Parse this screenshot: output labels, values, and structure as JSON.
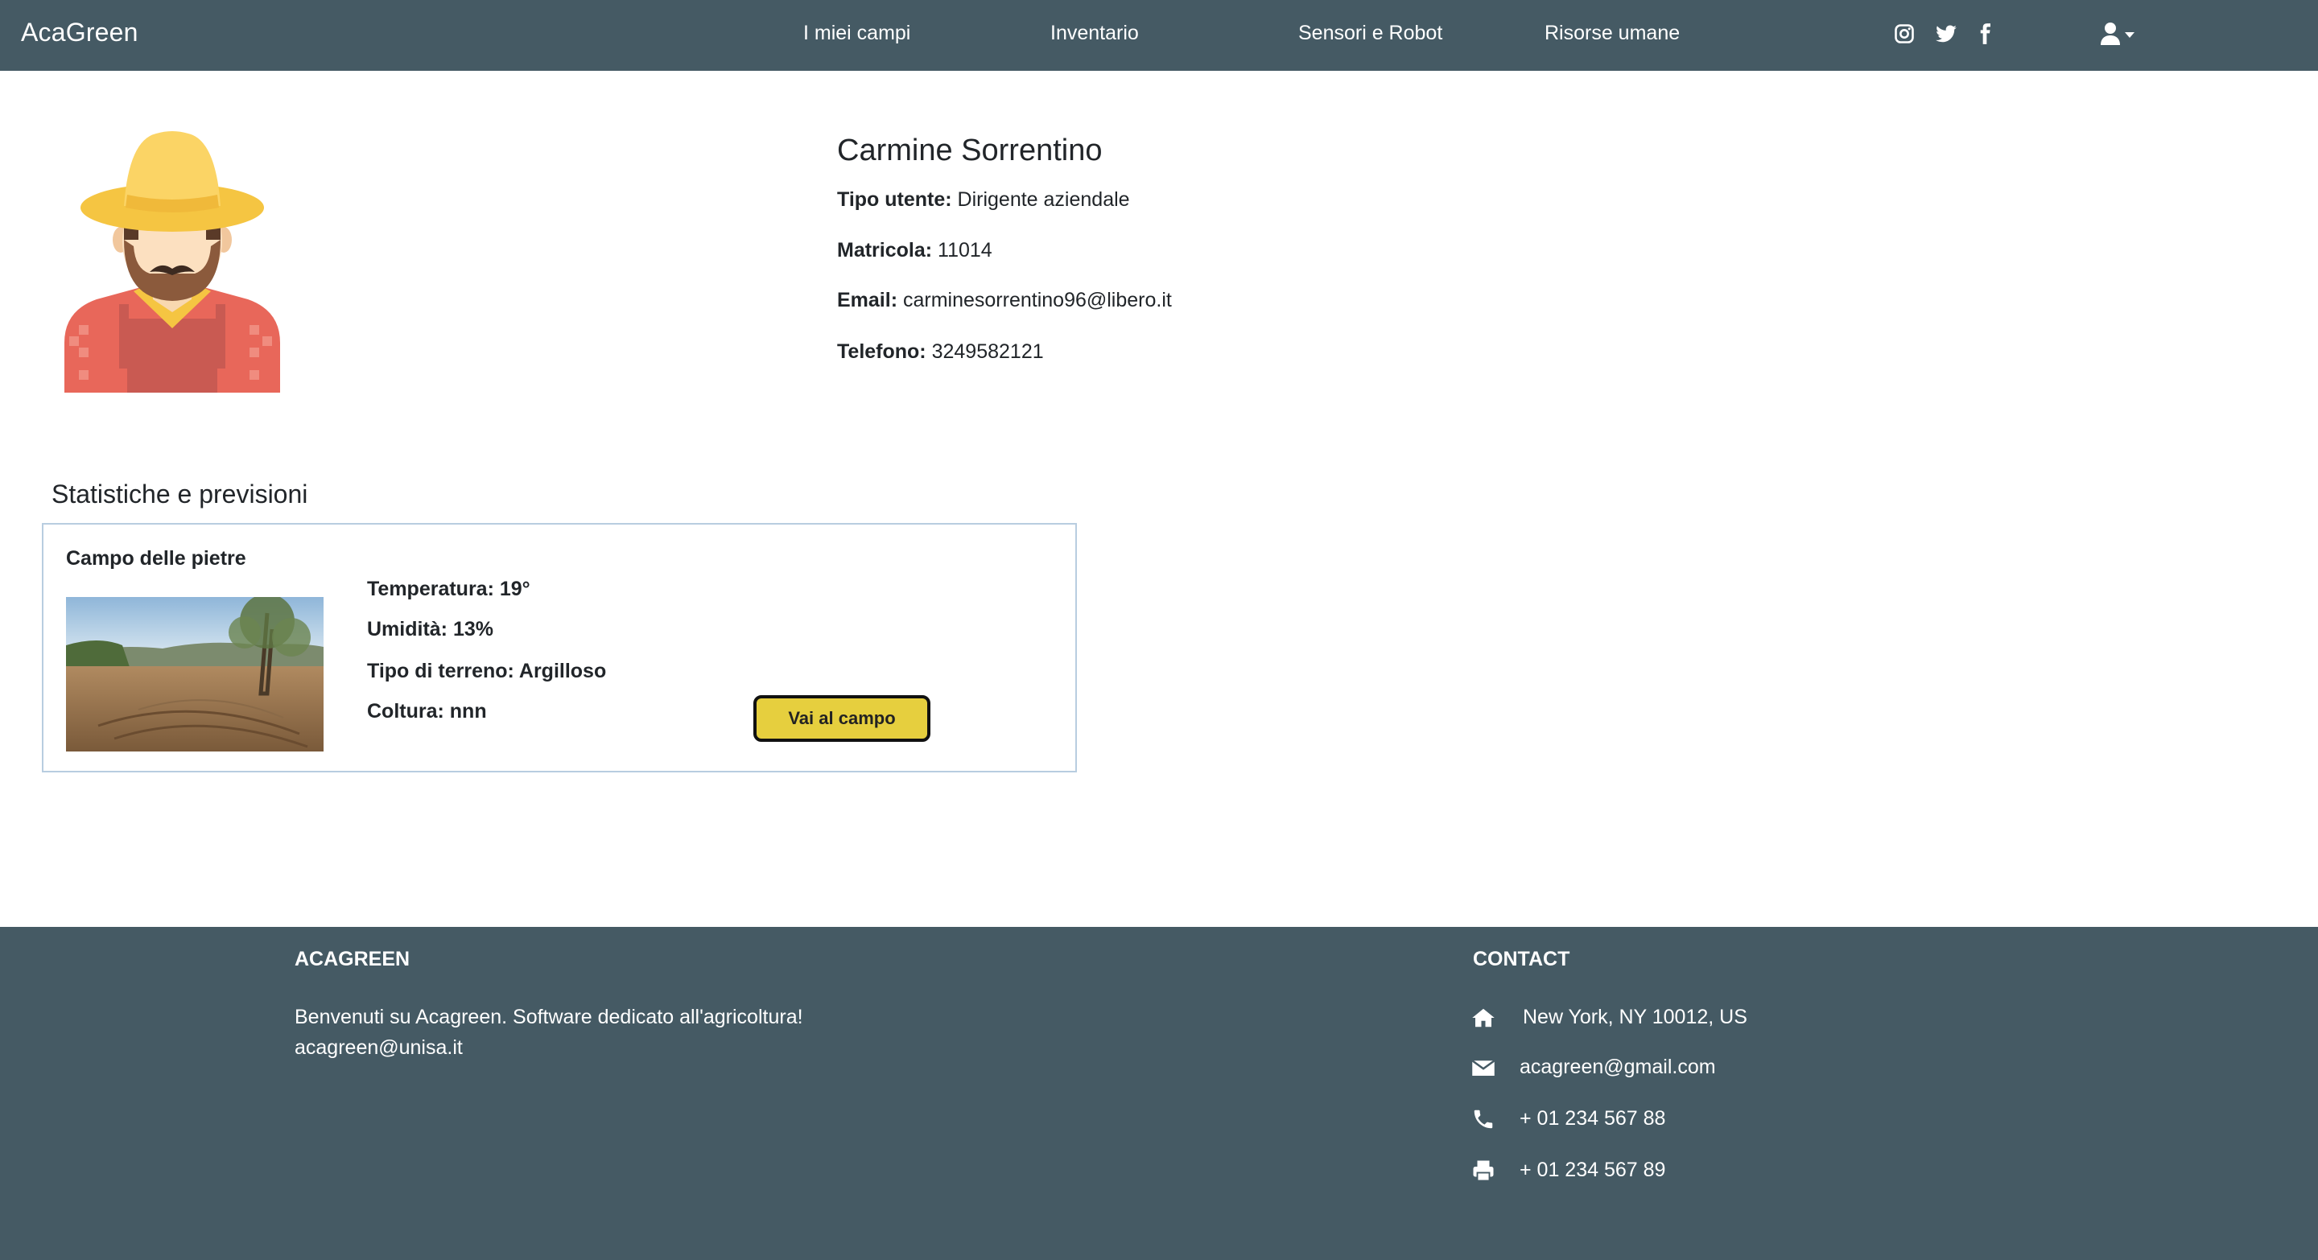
{
  "navbar": {
    "brand": "AcaGreen",
    "links": [
      "I miei campi",
      "Inventario",
      "Sensori e Robot",
      "Risorse umane"
    ],
    "social_icons": [
      "instagram-icon",
      "twitter-icon",
      "facebook-icon"
    ],
    "user_icon": "user-icon",
    "background": "#455a64"
  },
  "profile": {
    "name": "Carmine Sorrentino",
    "fields": [
      {
        "label": "Tipo utente:",
        "value": "Dirigente aziendale"
      },
      {
        "label": "Matricola:",
        "value": "11014"
      },
      {
        "label": "Email:",
        "value": "carminesorrentino96@libero.it"
      },
      {
        "label": "Telefono:",
        "value": "3249582121"
      }
    ]
  },
  "stats": {
    "title": "Statistiche e previsioni",
    "card": {
      "field_name": "Campo delle pietre",
      "temperature": "Temperatura: 19°",
      "humidity": "Umidità: 13%",
      "soil": "Tipo di terreno: Argilloso",
      "crop": "Coltura: nnn",
      "button_label": "Vai al campo",
      "button_color": "#e6cf3e"
    }
  },
  "footer": {
    "brand_heading": "ACAGREEN",
    "welcome": "Benvenuti su Acagreen. Software dedicato all'agricoltura!",
    "email": "acagreen@unisa.it",
    "contact_heading": "CONTACT",
    "contacts": [
      {
        "icon": "home-icon",
        "text": "New York, NY 10012, US"
      },
      {
        "icon": "envelope-icon",
        "text": "acagreen@gmail.com"
      },
      {
        "icon": "phone-icon",
        "text": "+ 01 234 567 88"
      },
      {
        "icon": "print-icon",
        "text": "+ 01 234 567 89"
      }
    ]
  }
}
